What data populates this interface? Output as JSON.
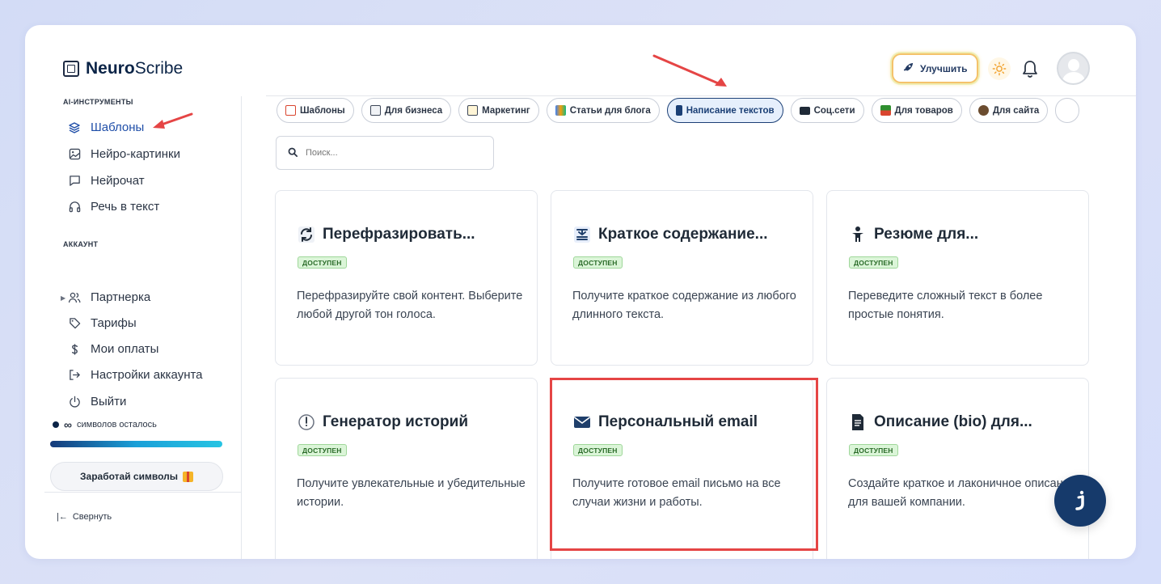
{
  "header": {
    "logo_bold": "Neuro",
    "logo_rest": "Scribe",
    "upgrade_label": "Улучшить"
  },
  "sidebar": {
    "section_tools": "AI-ИНСТРУМЕНТЫ",
    "tools": [
      {
        "label": "Шаблоны",
        "icon": "layers-icon",
        "active": true
      },
      {
        "label": "Нейро-картинки",
        "icon": "image-icon"
      },
      {
        "label": "Нейрочат",
        "icon": "chat-icon"
      },
      {
        "label": "Речь в текст",
        "icon": "headphones-icon"
      }
    ],
    "section_account": "АККАУНТ",
    "account": [
      {
        "label": "Партнерка",
        "icon": "users-icon"
      },
      {
        "label": "Тарифы",
        "icon": "tag-icon"
      },
      {
        "label": "Мои оплаты",
        "icon": "dollar-icon"
      },
      {
        "label": "Настройки аккаунта",
        "icon": "login-icon"
      },
      {
        "label": "Выйти",
        "icon": "power-icon"
      }
    ],
    "credits_value": "∞",
    "credits_text": "символов осталось",
    "earn_label": "Заработай символы",
    "collapse_label": "Свернуть"
  },
  "chips": [
    {
      "label": "Шаблоны",
      "color": "#d9452f"
    },
    {
      "label": "Для бизнеса",
      "color": "#6b7280"
    },
    {
      "label": "Маркетинг",
      "color": "#6b7280"
    },
    {
      "label": "Статьи для блога",
      "color": "#3b82f6"
    },
    {
      "label": "Написание текстов",
      "color": "#1b3f75",
      "active": true
    },
    {
      "label": "Соц.сети",
      "color": "#1f2a37"
    },
    {
      "label": "Для товаров",
      "color": "#2f8f2f"
    },
    {
      "label": "Для сайта",
      "color": "#6b4c2f"
    }
  ],
  "search": {
    "placeholder": "Поиск..."
  },
  "cards": [
    {
      "title": "Перефразировать...",
      "badge": "ДОСТУПЕН",
      "desc": "Перефразируйте свой контент. Выберите любой другой тон голоса.",
      "icon": "refresh-icon"
    },
    {
      "title": "Краткое содержание...",
      "badge": "ДОСТУПЕН",
      "desc": "Получите краткое содержание из любого длинного текста.",
      "icon": "compress-icon"
    },
    {
      "title": "Резюме для...",
      "badge": "ДОСТУПЕН",
      "desc": "Переведите сложный текст в более простые понятия.",
      "icon": "child-icon"
    },
    {
      "title": "Генератор историй",
      "badge": "ДОСТУПЕН",
      "desc": "Получите увлекательные и убедительные истории.",
      "icon": "clock-icon"
    },
    {
      "title": "Персональный email",
      "badge": "ДОСТУПЕН",
      "desc": "Получите готовое email письмо на все случаи жизни и работы.",
      "icon": "envelope-icon"
    },
    {
      "title": "Описание (bio) для...",
      "badge": "ДОСТУПЕН",
      "desc": "Создайте краткое и лаконичное описание для вашей компании.",
      "icon": "document-icon"
    }
  ],
  "colors": {
    "accent": "#1f4ea8",
    "brand": "#0b2447",
    "badge_bg": "#dbf5d8",
    "highlight": "#e54545"
  }
}
